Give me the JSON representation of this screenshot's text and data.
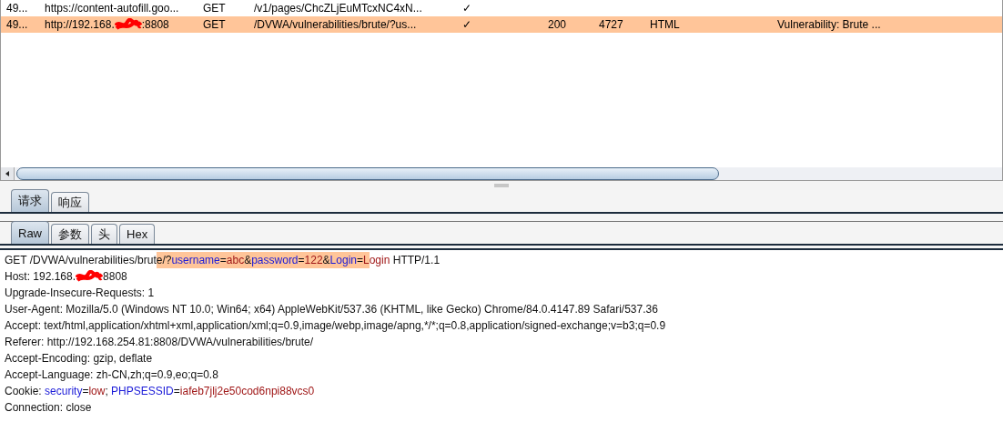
{
  "history": {
    "rows": [
      {
        "cells": [
          "49...",
          "https://content-autofill.goo...",
          "GET",
          "/v1/pages/ChcZLjEuMTcxNC4xN...",
          "✓"
        ],
        "selected": false
      },
      {
        "cells": [
          "49...",
          "http://192.168.",
          "GET",
          "/DVWA/vulnerabilities/brute/?us...",
          "✓",
          "200",
          "4727",
          "HTML",
          "Vulnerability: Brute ..."
        ],
        "url_tail": ":8808",
        "selected": true
      }
    ]
  },
  "main_tabs": [
    {
      "label": "请求",
      "selected": true
    },
    {
      "label": "响应",
      "selected": false
    }
  ],
  "sub_tabs": [
    {
      "label": "Raw",
      "selected": true
    },
    {
      "label": "参数",
      "selected": false
    },
    {
      "label": "头",
      "selected": false
    },
    {
      "label": "Hex",
      "selected": false
    }
  ],
  "request_lines": [
    {
      "segments": [
        {
          "text": "GET /DVWA/vulnerabilities/brut",
          "kind": "plain"
        },
        {
          "text": "e/?",
          "kind": "plain",
          "highlighted": true
        },
        {
          "text": "username",
          "kind": "name",
          "highlighted": true
        },
        {
          "text": "=",
          "kind": "plain",
          "highlighted": true
        },
        {
          "text": "abc",
          "kind": "value",
          "highlighted": true
        },
        {
          "text": "&",
          "kind": "plain",
          "highlighted": true
        },
        {
          "text": "password",
          "kind": "name",
          "highlighted": true
        },
        {
          "text": "=",
          "kind": "plain",
          "highlighted": true
        },
        {
          "text": "122",
          "kind": "value",
          "highlighted": true
        },
        {
          "text": "&",
          "kind": "plain",
          "highlighted": true
        },
        {
          "text": "Login",
          "kind": "name",
          "highlighted": true
        },
        {
          "text": "=",
          "kind": "plain",
          "highlighted": true
        },
        {
          "text": "L",
          "kind": "value",
          "highlighted": true
        },
        {
          "text": "ogin",
          "kind": "value"
        },
        {
          "text": " HTTP/1.1",
          "kind": "plain"
        }
      ]
    },
    {
      "segments": [
        {
          "text": "Host: 192.168.",
          "kind": "plain"
        },
        {
          "kind": "redacted"
        },
        {
          "text": "8808",
          "kind": "plain"
        }
      ]
    },
    {
      "segments": [
        {
          "text": "Upgrade-Insecure-Requests: 1",
          "kind": "plain"
        }
      ]
    },
    {
      "segments": [
        {
          "text": "User-Agent: Mozilla/5.0 (Windows NT 10.0; Win64; x64) AppleWebKit/537.36 (KHTML, like Gecko) Chrome/84.0.4147.89 Safari/537.36",
          "kind": "plain"
        }
      ]
    },
    {
      "segments": [
        {
          "text": "Accept: text/html,application/xhtml+xml,application/xml;q=0.9,image/webp,image/apng,*/*;q=0.8,application/signed-exchange;v=b3;q=0.9",
          "kind": "plain"
        }
      ]
    },
    {
      "segments": [
        {
          "text": "Referer: http://192.168.254.81:8808/DVWA/vulnerabilities/brute/",
          "kind": "plain"
        }
      ]
    },
    {
      "segments": [
        {
          "text": "Accept-Encoding: gzip, deflate",
          "kind": "plain"
        }
      ]
    },
    {
      "segments": [
        {
          "text": "Accept-Language: zh-CN,zh;q=0.9,eo;q=0.8",
          "kind": "plain"
        }
      ]
    },
    {
      "segments": [
        {
          "text": "Cookie: ",
          "kind": "plain"
        },
        {
          "text": "security",
          "kind": "name"
        },
        {
          "text": "=",
          "kind": "plain"
        },
        {
          "text": "low",
          "kind": "value"
        },
        {
          "text": "; ",
          "kind": "plain"
        },
        {
          "text": "PHPSESSID",
          "kind": "name"
        },
        {
          "text": "=",
          "kind": "plain"
        },
        {
          "text": "iafeb7jlj2e50cod6npi88vcs0",
          "kind": "value"
        }
      ]
    },
    {
      "segments": [
        {
          "text": "Connection: close",
          "kind": "plain"
        }
      ]
    }
  ]
}
